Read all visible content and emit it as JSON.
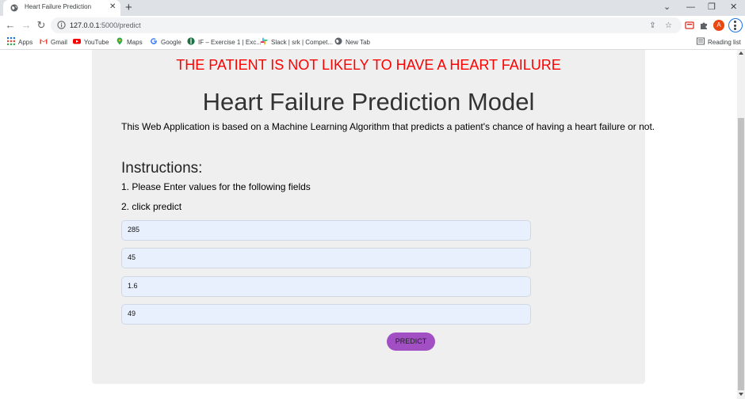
{
  "browser": {
    "tab": {
      "title": "Heart Failure Prediction",
      "favicon": "globe-icon",
      "close_icon": "close-icon"
    },
    "new_tab_icon": "plus-icon",
    "window_controls": [
      "chevron-down-icon",
      "minimize-icon",
      "restore-icon",
      "close-icon"
    ],
    "address": {
      "host": "127.0.0.1",
      "path": ":5000/predict"
    },
    "toolbar_icons": [
      "back-icon",
      "forward-icon",
      "reload-icon",
      "info-icon",
      "share-icon",
      "star-icon",
      "extension-pdf-icon",
      "puzzle-icon"
    ],
    "profile_initial": "A",
    "bookmarks": [
      {
        "label": "Apps",
        "icon": "apps-grid-icon",
        "color": "#1a73e8"
      },
      {
        "label": "Gmail",
        "icon": "gmail-icon",
        "color": "#ea4335"
      },
      {
        "label": "YouTube",
        "icon": "youtube-icon",
        "color": "#ff0000"
      },
      {
        "label": "Maps",
        "icon": "maps-icon",
        "color": "#34a853"
      },
      {
        "label": "Google",
        "icon": "google-icon",
        "color": "#4285f4"
      },
      {
        "label": "IF – Exercise 1 | Exc...",
        "icon": "excel-icon",
        "color": "#1d6f42"
      },
      {
        "label": "Slack | srk | Compet...",
        "icon": "slack-icon",
        "color": "#4a154b"
      },
      {
        "label": "New Tab",
        "icon": "globe-icon",
        "color": "#5f6368"
      }
    ],
    "reading_list": "Reading list"
  },
  "page": {
    "result": "THE PATIENT IS NOT LIKELY TO HAVE A HEART FAILURE",
    "heading": "Heart Failure Prediction Model",
    "description": "This Web Application is based on a Machine Learning Algorithm that predicts a patient's chance of having a heart failure or not.",
    "instructions_title": "Instructions:",
    "step1": "1. Please Enter values for the following fields",
    "step2": "2. click predict",
    "fields": [
      "285",
      "45",
      "1.6",
      "49"
    ],
    "button": "PREDICT"
  },
  "colors": {
    "result_text": "#ff0000",
    "card_background": "#efefef",
    "input_background": "#e8f0fe",
    "button": "#a14fc3"
  }
}
